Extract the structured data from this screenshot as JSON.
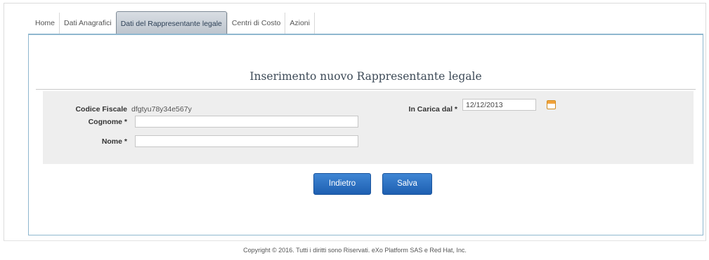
{
  "tabs": [
    {
      "label": "Home"
    },
    {
      "label": "Dati Anagrafici"
    },
    {
      "label": "Dati del Rappresentante legale"
    },
    {
      "label": "Centri di Costo"
    },
    {
      "label": "Azioni"
    }
  ],
  "form": {
    "title": "Inserimento nuovo Rappresentante legale",
    "codice_fiscale": {
      "label": "Codice Fiscale",
      "value": "dfgtyu78y34e567y"
    },
    "cognome": {
      "label": "Cognome *",
      "value": ""
    },
    "nome": {
      "label": "Nome *",
      "value": ""
    },
    "in_carica": {
      "label": "In Carica dal *",
      "value": "12/12/2013"
    }
  },
  "buttons": {
    "back": "Indietro",
    "save": "Salva"
  },
  "footer": "Copyright © 2016. Tutti i diritti sono Riservati. eXo Platform SAS e Red Hat, Inc.",
  "colors": {
    "button": "#2b6fc0",
    "panel_border": "#8fb7cf",
    "active_tab": "#c8cfd7"
  }
}
